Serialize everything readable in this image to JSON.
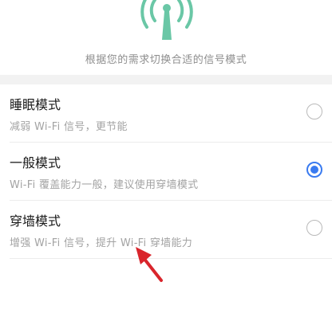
{
  "header": {
    "icon": "wifi-signal-icon",
    "subtitle": "根据您的需求切换合适的信号模式"
  },
  "modes": [
    {
      "title": "睡眠模式",
      "desc": "减弱 Wi-Fi 信号，更节能",
      "selected": false
    },
    {
      "title": "一般模式",
      "desc": "Wi-Fi 覆盖能力一般，建议使用穿墙模式",
      "selected": true
    },
    {
      "title": "穿墙模式",
      "desc": "增强 Wi-Fi 信号，提升 Wi-Fi 穿墙能力",
      "selected": false
    }
  ],
  "colors": {
    "accent": "#3a7bf0",
    "icon_green": "#6ac7a6",
    "annotation_arrow": "#d9252c"
  }
}
